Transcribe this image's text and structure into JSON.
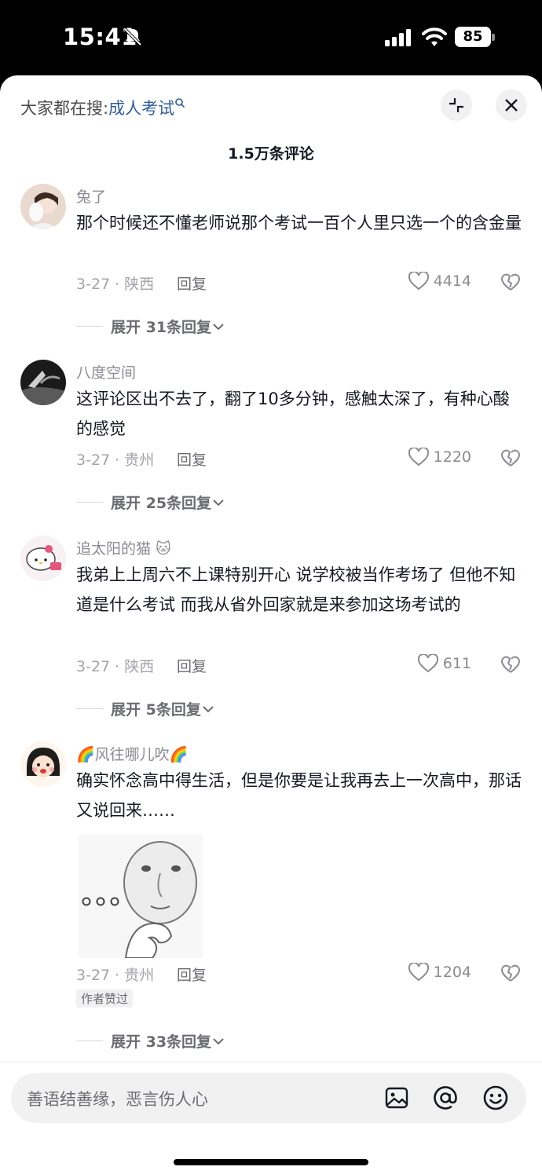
{
  "status_bar": {
    "time": "15:41",
    "battery": "85"
  },
  "header": {
    "search_prefix": "大家都在搜:",
    "search_keyword": "成人考试",
    "comment_count": "1.5万条评论"
  },
  "comments": [
    {
      "user": "兔了",
      "text": "那个时候还不懂老师说那个考试一百个人里只选一个的含金量",
      "date": "3-27 · 陕西",
      "reply": "回复",
      "likes": "4414",
      "expand": "展开 31条回复"
    },
    {
      "user": "八度空间",
      "text": "这评论区出不去了，翻了10多分钟，感触太深了，有种心酸的感觉",
      "date": "3-27 · 贵州",
      "reply": "回复",
      "likes": "1220",
      "expand": "展开 25条回复"
    },
    {
      "user": "追太阳的猫 🐱",
      "text": "我弟上上周六不上课特别开心 说学校被当作考场了 但他不知道是什么考试  而我从省外回家就是来参加这场考试的",
      "date": "3-27 · 陕西",
      "reply": "回复",
      "likes": "611",
      "expand": "展开 5条回复"
    },
    {
      "user": "🌈风往哪儿吹🌈",
      "text": "确实怀念高中得生活，但是你要是让我再去上一次高中，那话又说回来……",
      "date": "3-27 · 贵州",
      "reply": "回复",
      "likes": "1204",
      "badge": "作者赞过",
      "expand": "展开 33条回复"
    }
  ],
  "input": {
    "placeholder": "善语结善缘，恶言伤人心"
  }
}
